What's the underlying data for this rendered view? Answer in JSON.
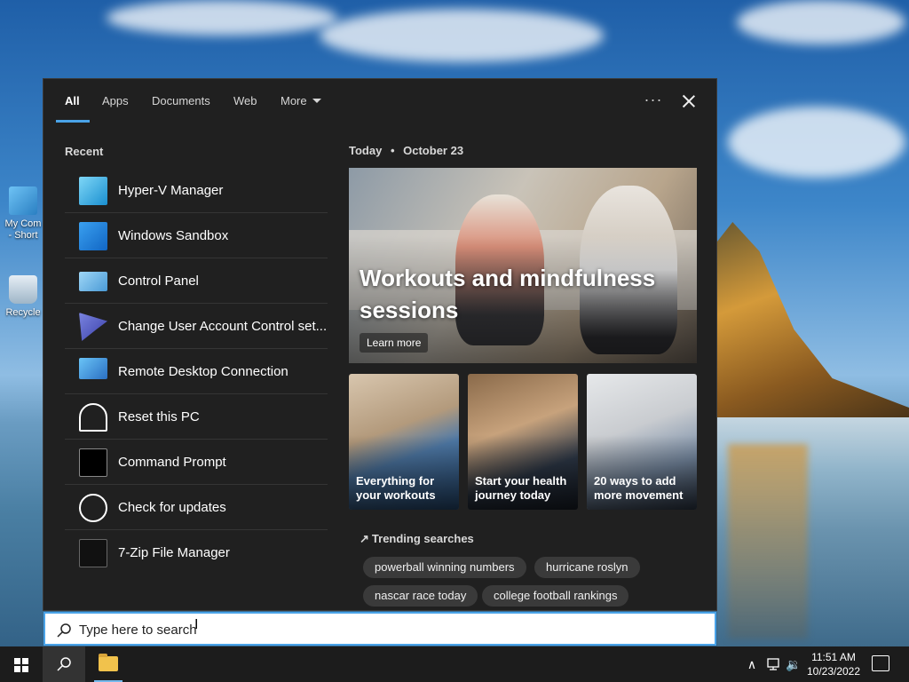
{
  "desktop": {
    "icons": [
      {
        "label_line1": "My Com",
        "label_line2": "- Short"
      },
      {
        "label_line1": "Recycle",
        "label_line2": ""
      }
    ]
  },
  "search_panel": {
    "tabs": [
      {
        "label": "All",
        "active": true
      },
      {
        "label": "Apps"
      },
      {
        "label": "Documents"
      },
      {
        "label": "Web"
      },
      {
        "label": "More"
      }
    ],
    "more_options_label": "···",
    "recent": {
      "heading": "Recent",
      "items": [
        {
          "label": "Hyper-V Manager",
          "icon": "hyperv-icon"
        },
        {
          "label": "Windows Sandbox",
          "icon": "sandbox-icon"
        },
        {
          "label": "Control Panel",
          "icon": "control-panel-icon"
        },
        {
          "label": "Change User Account Control set...",
          "icon": "uac-flag-icon"
        },
        {
          "label": "Remote Desktop Connection",
          "icon": "remote-desktop-icon"
        },
        {
          "label": "Reset this PC",
          "icon": "reset-pc-icon"
        },
        {
          "label": "Command Prompt",
          "icon": "command-prompt-icon"
        },
        {
          "label": "Check for updates",
          "icon": "refresh-icon"
        },
        {
          "label": "7-Zip File Manager",
          "icon": "7zip-icon"
        }
      ]
    },
    "today": {
      "label": "Today",
      "separator": "•",
      "date": "October 23",
      "hero": {
        "title": "Workouts and mindfulness sessions",
        "cta": "Learn more"
      },
      "cards": [
        {
          "caption": "Everything for your workouts"
        },
        {
          "caption": "Start your health journey today"
        },
        {
          "caption": "20 ways to add more movement"
        }
      ]
    },
    "trending": {
      "heading": "Trending searches",
      "chips": [
        "powerball winning numbers",
        "hurricane roslyn",
        "nascar race today",
        "college football rankings"
      ]
    }
  },
  "search_box": {
    "placeholder": "Type here to search",
    "value": ""
  },
  "taskbar": {
    "clock_time": "11:51 AM",
    "clock_date": "10/23/2022",
    "tray_chevron": "∧",
    "tray_volume": "🔉"
  },
  "colors": {
    "accent": "#4aa3e8",
    "panel_bg": "#202020",
    "taskbar_bg": "#1c1c1c",
    "chip_bg": "#3a3a3a"
  }
}
